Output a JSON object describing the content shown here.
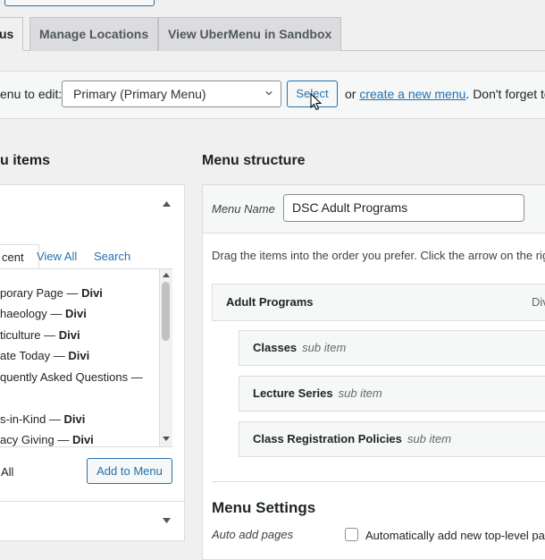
{
  "tabs": [
    {
      "label": "us"
    },
    {
      "label": "Manage Locations"
    },
    {
      "label": "View UberMenu in Sandbox"
    }
  ],
  "select_bar": {
    "label": "enu to edit:",
    "selected_menu": "Primary (Primary Menu)",
    "select_button": "Select",
    "or_text": "or",
    "create_link": "create a new menu",
    "after_text": ". Don't forget to sa"
  },
  "left_panel": {
    "heading": "u items",
    "tabs": [
      "cent",
      "View All",
      "Search"
    ],
    "items": [
      {
        "name": "porary Page",
        "sep": " — ",
        "tag": "Divi"
      },
      {
        "name": "haeology",
        "sep": " — ",
        "tag": "Divi"
      },
      {
        "name": "ticulture",
        "sep": " — ",
        "tag": "Divi"
      },
      {
        "name": "ate Today",
        "sep": " — ",
        "tag": "Divi"
      },
      {
        "name": "quently Asked Questions —",
        "sep": "",
        "tag": ""
      },
      {
        "name": "s-in-Kind",
        "sep": " — ",
        "tag": "Divi"
      },
      {
        "name": "acy Giving",
        "sep": " — ",
        "tag": "Divi"
      }
    ],
    "select_all": "All",
    "add_button": "Add to Menu"
  },
  "menu_structure": {
    "heading": "Menu structure",
    "menu_name_label": "Menu Name",
    "menu_name_value": "DSC Adult Programs",
    "instructions": "Drag the items into the order you prefer. Click the arrow on the rig",
    "top_item": {
      "title": "Adult Programs",
      "type": "Div"
    },
    "sub_items": [
      {
        "title": "Classes",
        "note": "sub item"
      },
      {
        "title": "Lecture Series",
        "note": "sub item"
      },
      {
        "title": "Class Registration Policies",
        "note": "sub item"
      }
    ],
    "settings_heading": "Menu Settings",
    "auto_add_label": "Auto add pages",
    "auto_add_text": "Automatically add new top-level pa"
  }
}
